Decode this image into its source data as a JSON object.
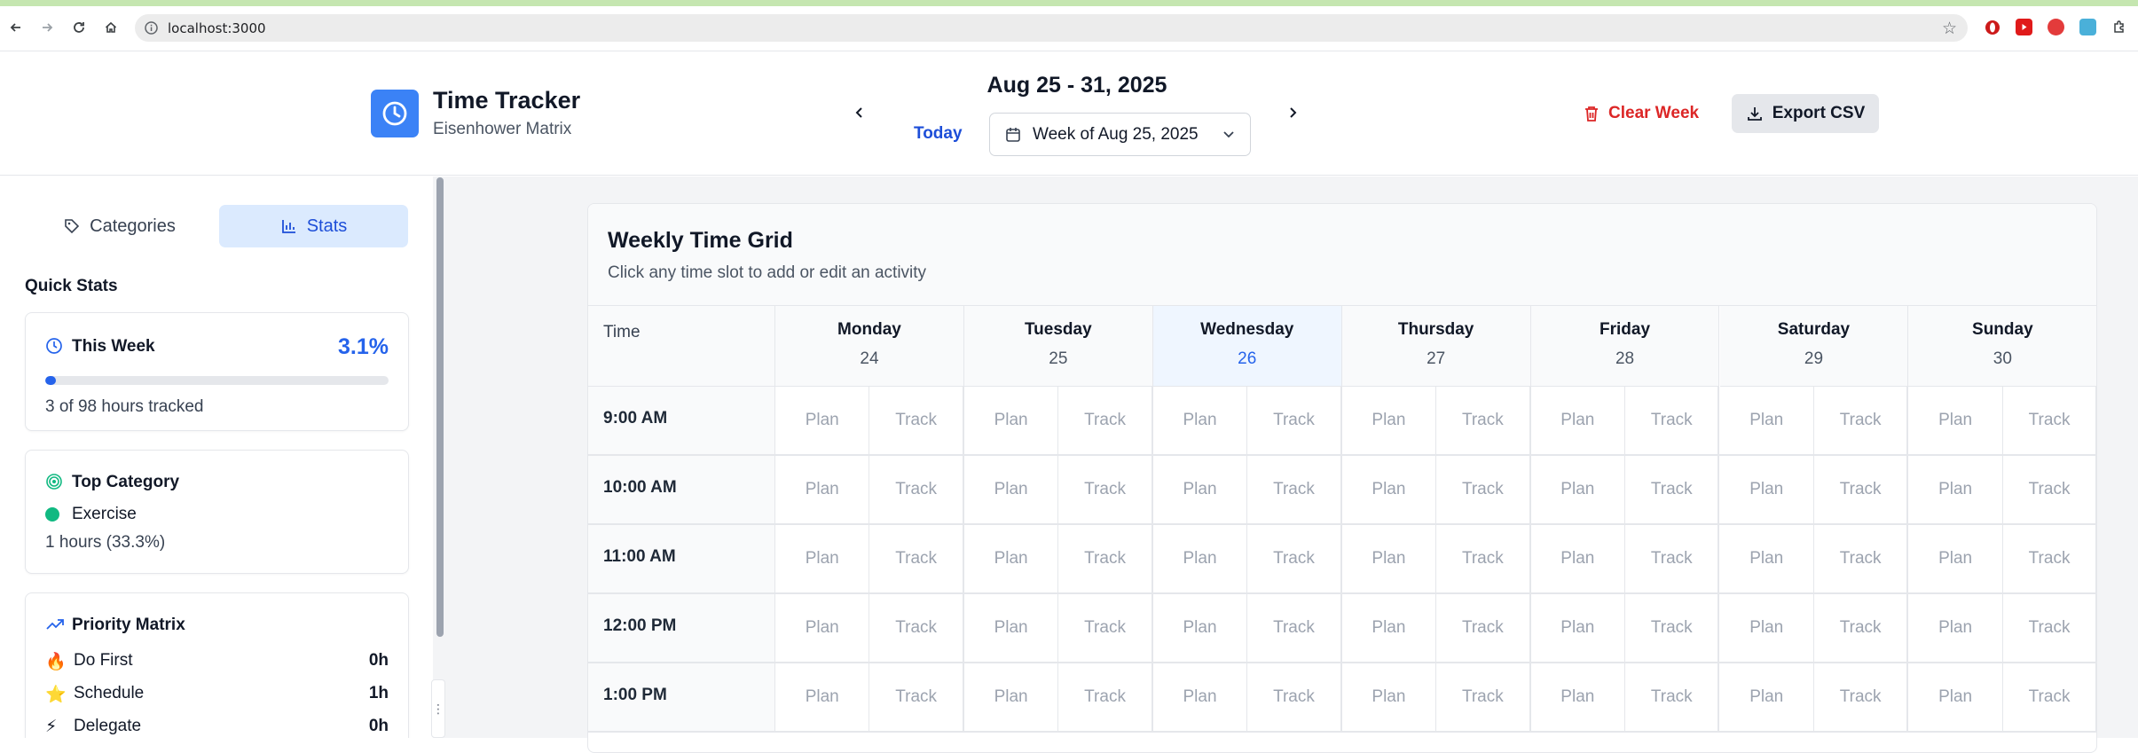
{
  "browser": {
    "url": "localhost:3000"
  },
  "header": {
    "app_title": "Time Tracker",
    "app_subtitle": "Eisenhower Matrix",
    "week_range": "Aug 25 - 31, 2025",
    "today_label": "Today",
    "week_select": "Week of Aug 25, 2025",
    "clear_week": "Clear Week",
    "export_csv": "Export CSV"
  },
  "sidebar": {
    "tabs": [
      {
        "label": "Categories",
        "active": false
      },
      {
        "label": "Stats",
        "active": true
      }
    ],
    "quick_stats_title": "Quick Stats",
    "this_week": {
      "title": "This Week",
      "percent": "3.1%",
      "progress_fraction": 0.031,
      "summary": "3 of 98 hours tracked"
    },
    "top_category": {
      "title": "Top Category",
      "name": "Exercise",
      "color": "#10b981",
      "detail": "1 hours (33.3%)"
    },
    "priority_matrix": {
      "title": "Priority Matrix",
      "rows": [
        {
          "emoji": "🔥",
          "label": "Do First",
          "value": "0h"
        },
        {
          "emoji": "⭐",
          "label": "Schedule",
          "value": "1h"
        },
        {
          "emoji": "⚡",
          "label": "Delegate",
          "value": "0h"
        }
      ]
    }
  },
  "grid": {
    "title": "Weekly Time Grid",
    "subtitle": "Click any time slot to add or edit an activity",
    "time_header": "Time",
    "plan_label": "Plan",
    "track_label": "Track",
    "days": [
      {
        "name": "Monday",
        "date": "24",
        "today": false
      },
      {
        "name": "Tuesday",
        "date": "25",
        "today": false
      },
      {
        "name": "Wednesday",
        "date": "26",
        "today": true
      },
      {
        "name": "Thursday",
        "date": "27",
        "today": false
      },
      {
        "name": "Friday",
        "date": "28",
        "today": false
      },
      {
        "name": "Saturday",
        "date": "29",
        "today": false
      },
      {
        "name": "Sunday",
        "date": "30",
        "today": false
      }
    ],
    "times": [
      "9:00 AM",
      "10:00 AM",
      "11:00 AM",
      "12:00 PM",
      "1:00 PM"
    ]
  },
  "colors": {
    "accent": "#2563eb",
    "danger": "#dc2626",
    "logo_bg": "#3b82f6"
  }
}
